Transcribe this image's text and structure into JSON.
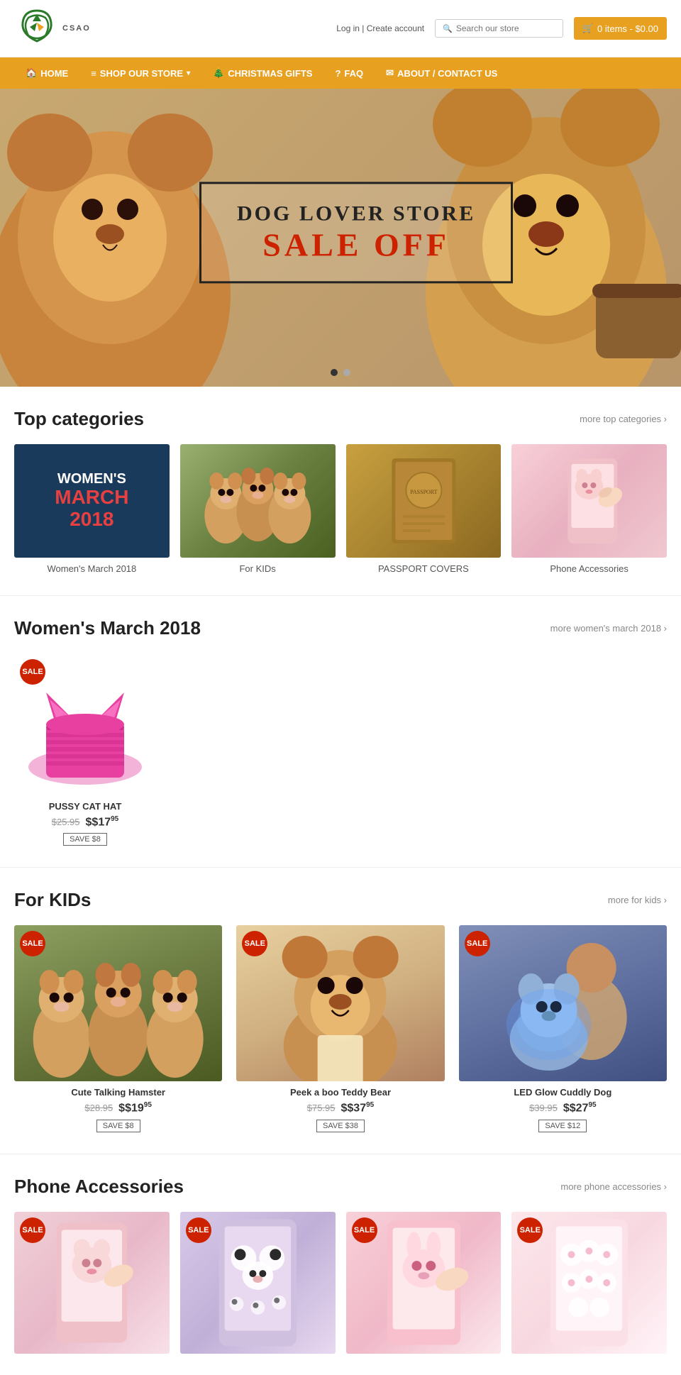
{
  "header": {
    "logo_text": "CSAO",
    "account_login": "Log in",
    "account_separator": " | ",
    "account_create": "Create account",
    "search_placeholder": "Search our store",
    "cart_label": "0 items - $0.00"
  },
  "nav": {
    "items": [
      {
        "id": "home",
        "label": "HOME",
        "icon": "🏠"
      },
      {
        "id": "shop",
        "label": "SHOP OUR STORE",
        "icon": "≡",
        "has_dropdown": true
      },
      {
        "id": "christmas",
        "label": "CHRISTMAS GIFTS",
        "icon": "🎄"
      },
      {
        "id": "faq",
        "label": "FAQ",
        "icon": "?"
      },
      {
        "id": "about",
        "label": "ABOUT / CONTACT US",
        "icon": "✉"
      }
    ]
  },
  "hero": {
    "title": "DOG LOVER STORE",
    "sale_text": "SALE OFF",
    "dot1": "active",
    "dot2": "inactive"
  },
  "top_categories": {
    "title": "Top categories",
    "more_link": "more top categories ›",
    "items": [
      {
        "id": "womens",
        "label": "Women's March 2018",
        "type": "womens"
      },
      {
        "id": "kids",
        "label": "For KIDs",
        "type": "hamsters"
      },
      {
        "id": "passport",
        "label": "PASSPORT COVERS",
        "type": "passport"
      },
      {
        "id": "phone",
        "label": "Phone Accessories",
        "type": "phone"
      }
    ]
  },
  "womens_march": {
    "title": "Women's March 2018",
    "more_link": "more women's march 2018 ›",
    "products": [
      {
        "id": "pussy-cat-hat",
        "name": "PUSSY CAT HAT",
        "price_old": "$25.95",
        "price_new": "$17",
        "price_new_cents": "95",
        "save": "SAVE $8",
        "has_sale": true
      }
    ]
  },
  "for_kids": {
    "title": "For KIDs",
    "more_link": "more for kids ›",
    "products": [
      {
        "id": "talking-hamster",
        "name": "Cute Talking Hamster",
        "price_old": "$28.95",
        "price_new": "$19",
        "price_new_cents": "95",
        "save": "SAVE $8",
        "has_sale": true
      },
      {
        "id": "teddy-bear",
        "name": "Peek a boo Teddy Bear",
        "price_old": "$75.95",
        "price_new": "$37",
        "price_new_cents": "95",
        "save": "SAVE $38",
        "has_sale": true
      },
      {
        "id": "glow-dog",
        "name": "LED Glow Cuddly Dog",
        "price_old": "$39.95",
        "price_new": "$27",
        "price_new_cents": "95",
        "save": "SAVE $12",
        "has_sale": true
      }
    ]
  },
  "phone_accessories": {
    "title": "Phone Accessories",
    "more_link": "more phone accessories ›",
    "products": [
      {
        "id": "phone1",
        "has_sale": true,
        "color": "pink1"
      },
      {
        "id": "phone2",
        "has_sale": true,
        "color": "panda"
      },
      {
        "id": "phone3",
        "has_sale": true,
        "color": "pink2"
      },
      {
        "id": "phone4",
        "has_sale": true,
        "color": "white"
      }
    ]
  },
  "labels": {
    "sale": "SALE",
    "womens_march_line1": "WOMEN'S",
    "womens_march_line2": "MARCH",
    "womens_march_line3": "2018"
  }
}
